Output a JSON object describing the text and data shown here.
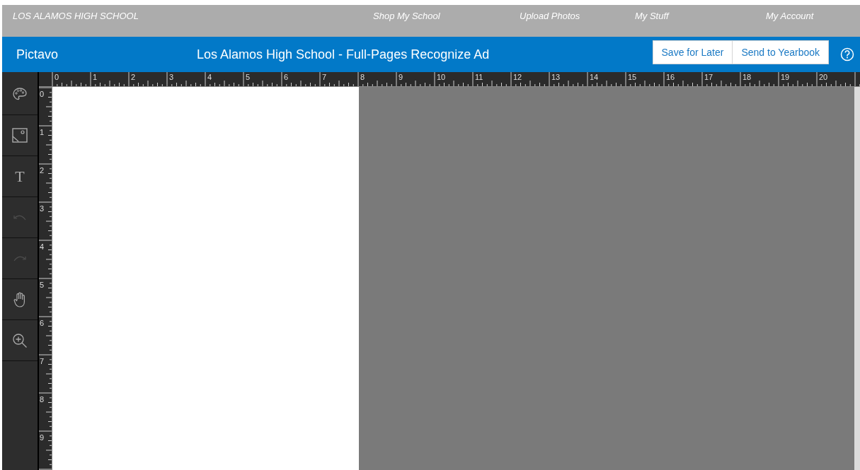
{
  "top_nav": {
    "school": "LOS ALAMOS HIGH SCHOOL",
    "links": [
      "Shop My School",
      "Upload Photos",
      "My Stuff",
      "My Account"
    ]
  },
  "header": {
    "brand": "Pictavo",
    "title": "Los Alamos High School - Full-Pages Recognize Ad",
    "buttons": [
      "Save for Later",
      "Send to Yearbook"
    ]
  },
  "tools": [
    {
      "kind": "palette",
      "disabled": false
    },
    {
      "kind": "image",
      "disabled": false
    },
    {
      "kind": "text",
      "glyph": "T",
      "disabled": false
    },
    {
      "kind": "undo",
      "disabled": true
    },
    {
      "kind": "redo",
      "disabled": true
    },
    {
      "kind": "hand",
      "disabled": false
    },
    {
      "kind": "zoom",
      "disabled": false
    }
  ],
  "horizontal_ruler": [
    "0",
    "1",
    "2",
    "3",
    "4",
    "5",
    "6",
    "7",
    "8",
    "9",
    "10",
    "11",
    "12",
    "13",
    "14",
    "15",
    "16",
    "17",
    "18",
    "19",
    "20"
  ],
  "vertical_ruler": [
    "0",
    "1",
    "2",
    "3",
    "4",
    "5",
    "6",
    "7",
    "8",
    "9"
  ]
}
